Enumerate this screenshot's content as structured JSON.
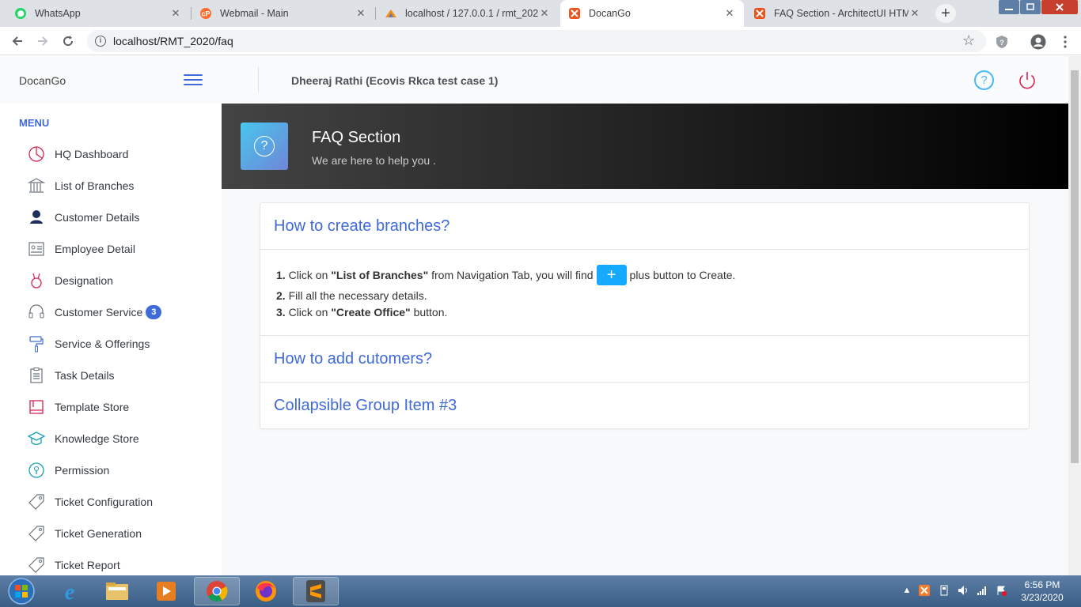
{
  "browser": {
    "tabs": [
      {
        "title": "WhatsApp"
      },
      {
        "title": "Webmail - Main"
      },
      {
        "title": "localhost / 127.0.0.1 / rmt_2020"
      },
      {
        "title": "DocanGo"
      },
      {
        "title": "FAQ Section - ArchitectUI HTML"
      }
    ],
    "url": "localhost/RMT_2020/faq"
  },
  "header": {
    "brand": "DocanGo",
    "user": "Dheeraj Rathi (Ecovis Rkca test case 1)"
  },
  "sidebar": {
    "heading": "MENU",
    "items": [
      {
        "label": "HQ Dashboard",
        "icon": "pie-chart-icon"
      },
      {
        "label": "List of Branches",
        "icon": "bank-icon"
      },
      {
        "label": "Customer Details",
        "icon": "user-icon"
      },
      {
        "label": "Employee Detail",
        "icon": "id-card-icon"
      },
      {
        "label": "Designation",
        "icon": "medal-icon"
      },
      {
        "label": "Customer Service",
        "icon": "headset-icon",
        "badge": "3"
      },
      {
        "label": "Service & Offerings",
        "icon": "paint-roller-icon"
      },
      {
        "label": "Task Details",
        "icon": "clipboard-icon"
      },
      {
        "label": "Template Store",
        "icon": "template-icon"
      },
      {
        "label": "Knowledge Store",
        "icon": "graduation-cap-icon"
      },
      {
        "label": "Permission",
        "icon": "key-icon"
      },
      {
        "label": "Ticket Configuration",
        "icon": "tag-icon"
      },
      {
        "label": "Ticket Generation",
        "icon": "tag-icon"
      },
      {
        "label": "Ticket Report",
        "icon": "tag-icon"
      }
    ]
  },
  "page": {
    "title": "FAQ Section",
    "subtitle": "We are here to help you ."
  },
  "faq": {
    "q1": "How to create branches?",
    "steps": [
      {
        "num": "1.",
        "pre": "Click on",
        "bold": "\"List of Branches\"",
        "mid": "from Navigation Tab, you will find",
        "btn": "+",
        "post": "plus button to Create."
      },
      {
        "num": "2.",
        "text": "Fill all the necessary details."
      },
      {
        "num": "3.",
        "pre": "Click on",
        "bold": "\"Create Office\"",
        "post": "button."
      }
    ],
    "q2": "How to add cutomers?",
    "q3": "Collapsible Group Item #3"
  },
  "taskbar": {
    "time": "6:56 PM",
    "date": "3/23/2020"
  },
  "colors": {
    "primary": "#3f6ad8",
    "info": "#16aaff",
    "danger": "#d92550",
    "help": "#49b8f5"
  }
}
